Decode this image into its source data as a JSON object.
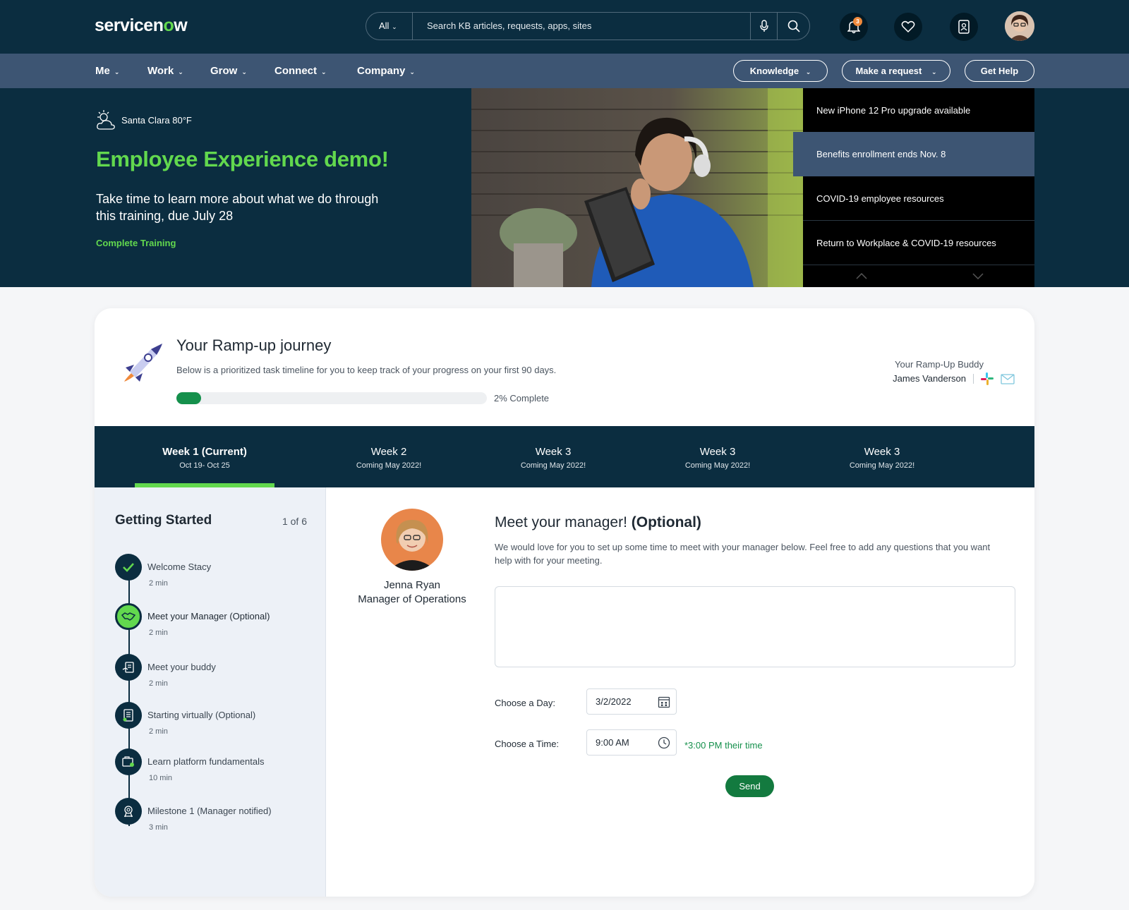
{
  "header": {
    "logo_text": "servicen",
    "logo_o": "o",
    "logo_end": "w",
    "search_scope": "All",
    "search_placeholder": "Search KB articles, requests, apps, sites",
    "notification_count": "3",
    "icons": [
      "bell-icon",
      "heart-icon",
      "contact-card-icon"
    ]
  },
  "nav": {
    "items": [
      "Me",
      "Work",
      "Grow",
      "Connect",
      "Company"
    ],
    "pills": [
      "Knowledge",
      "Make a request",
      "Get Help"
    ]
  },
  "hero": {
    "weather": "Santa Clara 80°F",
    "title": "Employee Experience demo!",
    "subtitle": "Take time to learn more about what we do through this training, due July 28",
    "link": "Complete Training",
    "news": [
      "New iPhone 12 Pro upgrade available",
      "Benefits enrollment ends Nov. 8",
      "COVID-19 employee resources",
      "Return to Workplace & COVID-19 resources"
    ],
    "active_news_index": 1
  },
  "journey": {
    "title": "Your Ramp-up journey",
    "subtitle": "Below is a prioritized task timeline for you to keep track of your progress on your first 90 days.",
    "progress_percent": 2,
    "progress_label": "2% Complete",
    "buddy_label": "Your Ramp-Up Buddy",
    "buddy_name": "James Vanderson"
  },
  "weeks": [
    {
      "label": "Week 1 (Current)",
      "dates": "Oct 19- Oct 25"
    },
    {
      "label": "Week 2",
      "dates": "Coming May 2022!"
    },
    {
      "label": "Week 3",
      "dates": "Coming May 2022!"
    },
    {
      "label": "Week 3",
      "dates": "Coming May 2022!"
    },
    {
      "label": "Week 3",
      "dates": "Coming May 2022!"
    }
  ],
  "getting_started": {
    "title": "Getting Started",
    "count": "1 of 6",
    "steps": [
      {
        "label": "Welcome Stacy",
        "duration": "2 min",
        "icon": "check-icon"
      },
      {
        "label": "Meet your Manager (Optional)",
        "duration": "2 min",
        "icon": "handshake-icon"
      },
      {
        "label": "Meet your buddy",
        "duration": "2 min",
        "icon": "document-hand-icon"
      },
      {
        "label": "Starting virtually (Optional)",
        "duration": "2 min",
        "icon": "checklist-icon"
      },
      {
        "label": "Learn platform fundamentals",
        "duration": "10 min",
        "icon": "platform-icon"
      },
      {
        "label": "Milestone 1 (Manager notified)",
        "duration": "3 min",
        "icon": "award-icon"
      }
    ]
  },
  "meeting": {
    "manager_name": "Jenna Ryan",
    "manager_role": "Manager of Operations",
    "title": "Meet your manager!",
    "title_suffix": "(Optional)",
    "description": "We would love for you to set up some time to meet with your manager below. Feel free to add any questions that you want help with for your meeting.",
    "notes_value": "",
    "day_label": "Choose a Day:",
    "day_value": "3/2/2022",
    "time_label": "Choose a Time:",
    "time_value": "9:00 AM",
    "their_time": "*3:00 PM their time",
    "send_label": "Send"
  },
  "colors": {
    "navy": "#0b2d40",
    "nav_blue": "#3d5573",
    "brand_green": "#62d84e",
    "action_green": "#137a3f"
  }
}
